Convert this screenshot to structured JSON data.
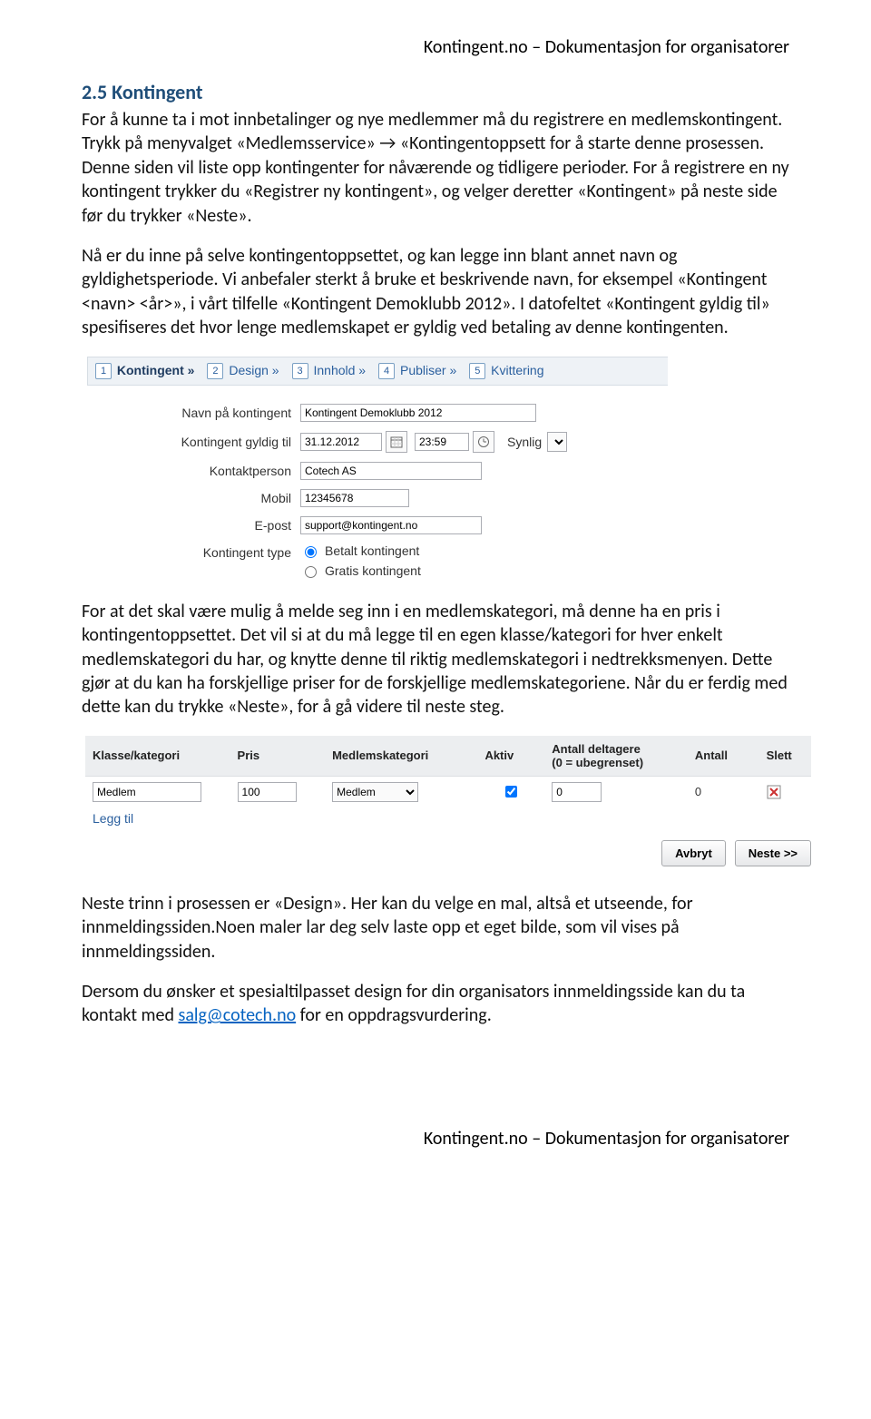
{
  "header": "Kontingent.no – Dokumentasjon for organisatorer",
  "footer": "Kontingent.no – Dokumentasjon for organisatorer",
  "section_title": "2.5 Kontingent",
  "p1": "For å kunne ta i mot innbetalinger og nye medlemmer må du registrere en medlemskontingent. Trykk på menyvalget «Medlemsservice» → «Kontingentoppsett for å starte denne prosessen. Denne siden vil liste opp kontingenter for nåværende og tidligere perioder. For å registrere en ny kontingent trykker du «Registrer ny kontingent», og velger deretter «Kontingent» på neste side før du trykker «Neste».",
  "p2": "Nå er du inne på selve kontingentoppsettet, og kan legge inn blant annet navn og gyldighetsperiode. Vi anbefaler sterkt å bruke et beskrivende navn, for eksempel «Kontingent <navn> <år>», i vårt tilfelle «Kontingent Demoklubb 2012». I datofeltet «Kontingent gyldig til» spesifiseres det hvor lenge medlemskapet er gyldig ved betaling av denne kontingenten.",
  "p3": "For at det skal være mulig å melde seg inn i en medlemskategori, må denne ha en pris i kontingentoppsettet. Det vil si at du må legge til en egen klasse/kategori for hver enkelt medlemskategori du har, og knytte denne til riktig medlemskategori i nedtrekksmenyen. Dette gjør at du kan ha forskjellige priser for de forskjellige medlemskategoriene. Når du er ferdig med dette kan du trykke «Neste», for å gå videre til neste steg.",
  "p4_a": "Neste trinn i prosessen er «Design». Her kan du velge en mal, altså et utseende, for innmeldingssiden.Noen maler lar deg selv laste opp et eget bilde, som vil vises på innmeldingssiden.",
  "p4_b_before": "Dersom du ønsker et spesialtilpasset design for din organisators innmeldingsside kan du ta kontakt med ",
  "p4_b_link": "salg@cotech.no",
  "p4_b_after": " for en oppdragsvurdering.",
  "shot1": {
    "steps": [
      {
        "num": "1",
        "label": "Kontingent »",
        "active": true
      },
      {
        "num": "2",
        "label": "Design »",
        "active": false
      },
      {
        "num": "3",
        "label": "Innhold »",
        "active": false
      },
      {
        "num": "4",
        "label": "Publiser »",
        "active": false
      },
      {
        "num": "5",
        "label": "Kvittering",
        "active": false
      }
    ],
    "form": {
      "name_label": "Navn på kontingent",
      "name_value": "Kontingent Demoklubb 2012",
      "valid_label": "Kontingent gyldig til",
      "valid_date": "31.12.2012",
      "valid_time": "23:59",
      "visibility_label": "Synlig",
      "contact_label": "Kontaktperson",
      "contact_value": "Cotech AS",
      "mobile_label": "Mobil",
      "mobile_value": "12345678",
      "email_label": "E-post",
      "email_value": "support@kontingent.no",
      "type_label": "Kontingent type",
      "type_options": {
        "paid": "Betalt kontingent",
        "free": "Gratis kontingent"
      }
    }
  },
  "shot2": {
    "headers": {
      "klasse": "Klasse/kategori",
      "pris": "Pris",
      "medlemskategori": "Medlemskategori",
      "aktiv": "Aktiv",
      "deltagere": "Antall deltagere\n(0 = ubegrenset)",
      "antall": "Antall",
      "slett": "Slett"
    },
    "row": {
      "klasse": "Medlem",
      "pris": "100",
      "medlemskategori": "Medlem",
      "aktiv_checked": true,
      "deltagere": "0",
      "antall": "0"
    },
    "add_link": "Legg til",
    "btn_cancel": "Avbryt",
    "btn_next": "Neste >>"
  }
}
